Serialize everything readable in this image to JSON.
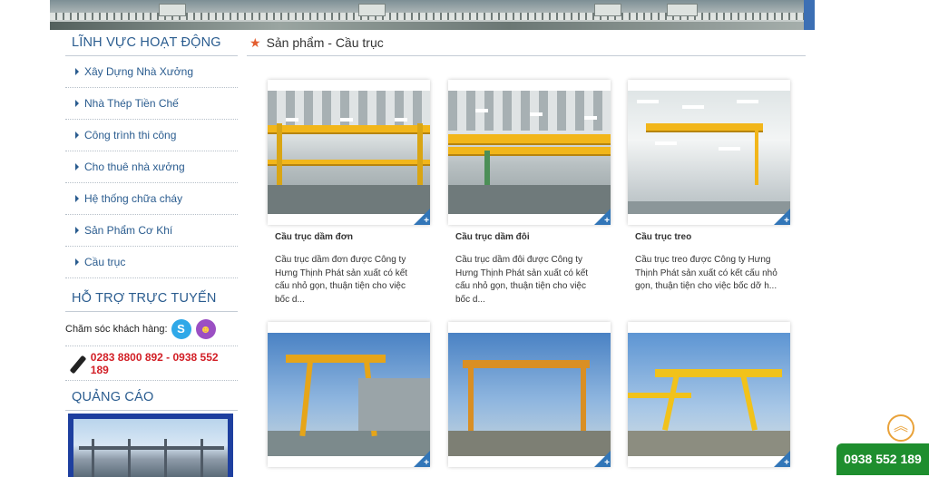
{
  "sidebar": {
    "section_title": "LĨNH VỰC HOẠT ĐỘNG",
    "items": [
      {
        "label": "Xây Dựng Nhà Xưởng"
      },
      {
        "label": "Nhà Thép Tiền Chế"
      },
      {
        "label": "Công trình thi công"
      },
      {
        "label": "Cho thuê nhà xưởng"
      },
      {
        "label": "Hệ thống chữa cháy"
      },
      {
        "label": "Sản Phẩm Cơ Khí"
      },
      {
        "label": "Cầu trục"
      }
    ],
    "support_title": "HỖ TRỢ TRỰC TUYẾN",
    "support_label": "Chăm sóc khách hàng:",
    "phone": "0283 8800 892 - 0938 552 189",
    "ads_title": "QUẢNG CÁO"
  },
  "breadcrumb": "Sản phẩm - Cầu trục",
  "products": [
    {
      "title": "Cầu trục dầm đơn",
      "desc": "Cầu trục dầm đơn được Công ty Hưng Thịnh Phát sản xuất có kết cấu nhỏ gọn, thuận tiện cho việc bốc d..."
    },
    {
      "title": "Cầu trục dầm đôi",
      "desc": "Cầu trục dầm đôi được Công ty Hưng Thịnh Phát sản xuất có kết cấu nhỏ gọn, thuận tiện cho việc bốc d..."
    },
    {
      "title": "Cầu trục treo",
      "desc": "Cầu trục treo được Công ty Hưng Thịnh Phát sản xuất có kết cấu nhỏ gọn, thuận tiện cho việc bốc dỡ h..."
    }
  ],
  "hotline": "0938 552 189",
  "colors": {
    "link": "#2a5c8f",
    "phone": "#d21f26",
    "hotline_bg": "#1e8e2e",
    "accent": "#3276b8"
  }
}
